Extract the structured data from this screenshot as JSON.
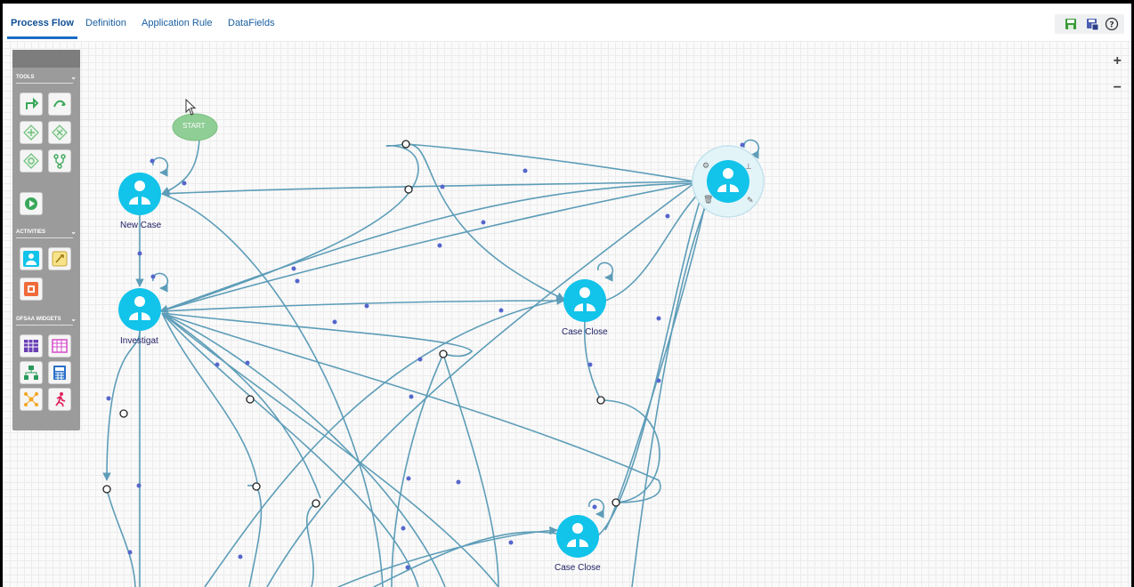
{
  "tabs": [
    {
      "label": "Process Flow",
      "active": true
    },
    {
      "label": "Definition",
      "active": false
    },
    {
      "label": "Application Rule",
      "active": false
    },
    {
      "label": "DataFields",
      "active": false
    }
  ],
  "toolbar": {
    "icons": [
      "save-icon",
      "save-as-icon",
      "help-icon"
    ]
  },
  "zoom": {
    "in": "+",
    "out": "−"
  },
  "palette": {
    "sections": [
      "TOOLS",
      "ACTIVITIES",
      "OFSAA WIDGETS"
    ]
  },
  "nodes": {
    "start": "START",
    "new_case": "New Case",
    "investigate": "Investigat",
    "case_close_1": "Case Close",
    "case_close_2": "Case Close"
  },
  "colors": {
    "node": "#12c3ea",
    "start": "#8fce95",
    "edge": "#5d9db8",
    "tab_active": "#1a6cc4"
  }
}
